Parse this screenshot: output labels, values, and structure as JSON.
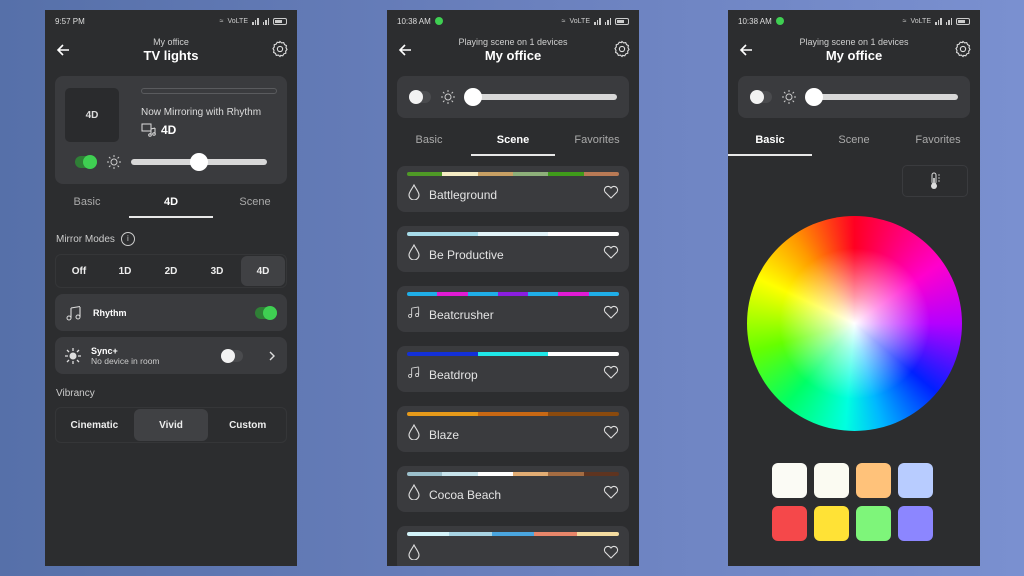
{
  "panels": [
    {
      "status": {
        "time": "9:57 PM",
        "network": "VoLTE",
        "has_dot": false
      },
      "header": {
        "subtitle": "My office",
        "title": "TV lights"
      },
      "mirror": {
        "thumb_label": "4D",
        "status_text": "Now Mirroring with Rhythm",
        "mode": "4D",
        "power_on": true,
        "brightness_percent": 50
      },
      "tabs": [
        {
          "label": "Basic",
          "active": false
        },
        {
          "label": "4D",
          "active": true
        },
        {
          "label": "Scene",
          "active": false
        }
      ],
      "mirror_modes": {
        "label": "Mirror Modes",
        "info_icon": "i",
        "options": [
          {
            "label": "Off"
          },
          {
            "label": "1D"
          },
          {
            "label": "2D"
          },
          {
            "label": "3D"
          },
          {
            "label": "4D"
          }
        ],
        "selected": "4D"
      },
      "rhythm": {
        "label": "Rhythm",
        "enabled": true
      },
      "sync": {
        "label": "Sync+",
        "sublabel": "No device in room",
        "enabled": false
      },
      "vibrancy": {
        "label": "Vibrancy",
        "options": [
          {
            "label": "Cinematic"
          },
          {
            "label": "Vivid"
          },
          {
            "label": "Custom"
          }
        ],
        "selected": "Vivid"
      }
    },
    {
      "status": {
        "time": "10:38 AM",
        "network": "VoLTE",
        "has_dot": true
      },
      "header": {
        "subtitle": "Playing scene on 1 devices",
        "title": "My office"
      },
      "controls": {
        "power_on": false,
        "brightness_percent": 0
      },
      "tabs": [
        {
          "label": "Basic",
          "active": false
        },
        {
          "label": "Scene",
          "active": true
        },
        {
          "label": "Favorites",
          "active": false
        }
      ],
      "scenes": [
        {
          "name": "Battleground",
          "icon": "droplet",
          "colors": [
            "#4f9a26",
            "#f5ecc4",
            "#c8a064",
            "#8db07a",
            "#3f9b1a",
            "#b97a55"
          ]
        },
        {
          "name": "Be Productive",
          "icon": "droplet",
          "colors": [
            "#a8dcea",
            "#e3f4f9",
            "#ffffff"
          ]
        },
        {
          "name": "Beatcrusher",
          "icon": "music-note",
          "colors": [
            "#1faee8",
            "#e11bd5",
            "#1faee8",
            "#8a1ee0",
            "#1faee8",
            "#e11bd5",
            "#1faee8"
          ]
        },
        {
          "name": "Beatdrop",
          "icon": "music-note",
          "colors": [
            "#1330d8",
            "#1fe8e8",
            "#ffffff"
          ]
        },
        {
          "name": "Blaze",
          "icon": "droplet",
          "colors": [
            "#e69a1a",
            "#c86814",
            "#8a4a0e"
          ]
        },
        {
          "name": "Cocoa Beach",
          "icon": "droplet",
          "colors": [
            "#9cc0cc",
            "#c8e4ec",
            "#ffffff",
            "#e2ad74",
            "#a46c42",
            "#5e3420"
          ]
        },
        {
          "name": "",
          "icon": "droplet",
          "colors": [
            "#d4f4fa",
            "#a8d4e4",
            "#4aa6e0",
            "#e8866a",
            "#f4dca0"
          ]
        }
      ]
    },
    {
      "status": {
        "time": "10:38 AM",
        "network": "VoLTE",
        "has_dot": true
      },
      "header": {
        "subtitle": "Playing scene on 1 devices",
        "title": "My office"
      },
      "controls": {
        "power_on": false,
        "brightness_percent": 0
      },
      "tabs": [
        {
          "label": "Basic",
          "active": true
        },
        {
          "label": "Scene",
          "active": false
        },
        {
          "label": "Favorites",
          "active": false
        }
      ],
      "color_temperature_icon": "thermometer-icon",
      "swatches": [
        "#fbfbf5",
        "#fbfbf2",
        "#ffc27a",
        "#b8ccff",
        "#f5484a",
        "#ffe236",
        "#7ef57a",
        "#8c86ff"
      ]
    }
  ]
}
